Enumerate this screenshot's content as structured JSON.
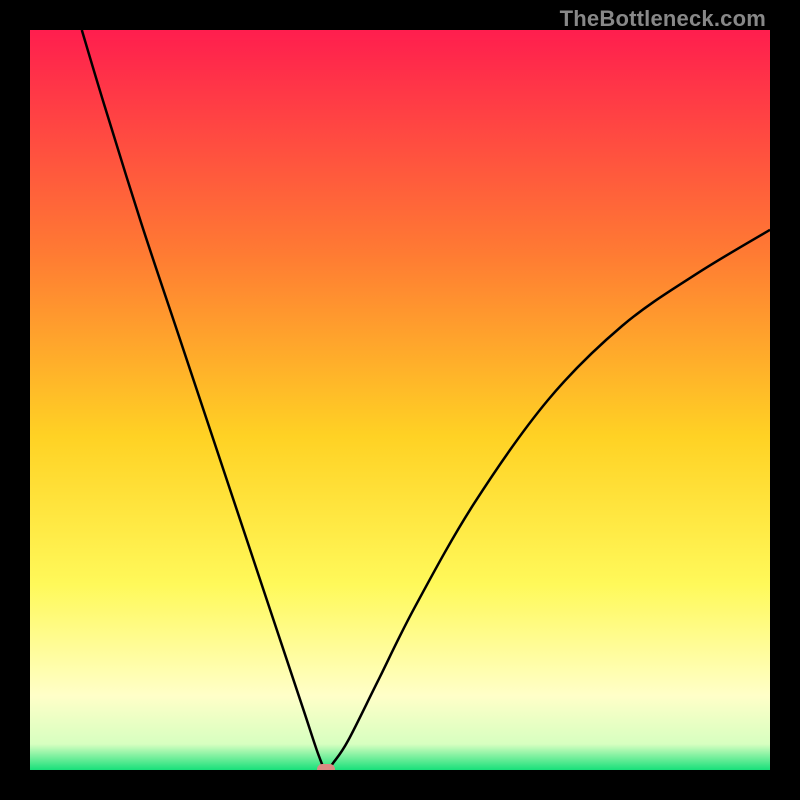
{
  "watermark": "TheBottleneck.com",
  "colors": {
    "frame": "#000000",
    "top": "#ff1e4e",
    "upper_mid": "#ff7a33",
    "mid": "#ffd224",
    "lower_mid": "#fff95a",
    "pale": "#ffffc8",
    "bottom": "#18e07a",
    "curve": "#000000",
    "marker": "#d98b84",
    "watermark_text": "#888888"
  },
  "chart_data": {
    "type": "line",
    "title": "",
    "xlabel": "",
    "ylabel": "",
    "xlim": [
      0,
      100
    ],
    "ylim": [
      0,
      100
    ],
    "note": "V-shaped bottleneck curve; minimum near x≈40 at y≈0. Left branch starts near (7,100), right branch ends near (100,73). Values estimated from pixels.",
    "series": [
      {
        "name": "bottleneck-curve",
        "x": [
          7,
          10,
          15,
          20,
          25,
          30,
          34,
          37,
          39,
          40,
          41,
          43,
          47,
          52,
          60,
          70,
          80,
          90,
          100
        ],
        "y": [
          100,
          90,
          74,
          59,
          44,
          29,
          17,
          8,
          2,
          0,
          1,
          4,
          12,
          22,
          36,
          50,
          60,
          67,
          73
        ]
      }
    ],
    "marker": {
      "x": 40,
      "y": 0
    },
    "background_gradient_stops": [
      {
        "pos": 0.0,
        "color": "#ff1e4e"
      },
      {
        "pos": 0.3,
        "color": "#ff7a33"
      },
      {
        "pos": 0.55,
        "color": "#ffd224"
      },
      {
        "pos": 0.75,
        "color": "#fff95a"
      },
      {
        "pos": 0.9,
        "color": "#ffffc8"
      },
      {
        "pos": 0.965,
        "color": "#d7ffc0"
      },
      {
        "pos": 1.0,
        "color": "#18e07a"
      }
    ]
  }
}
